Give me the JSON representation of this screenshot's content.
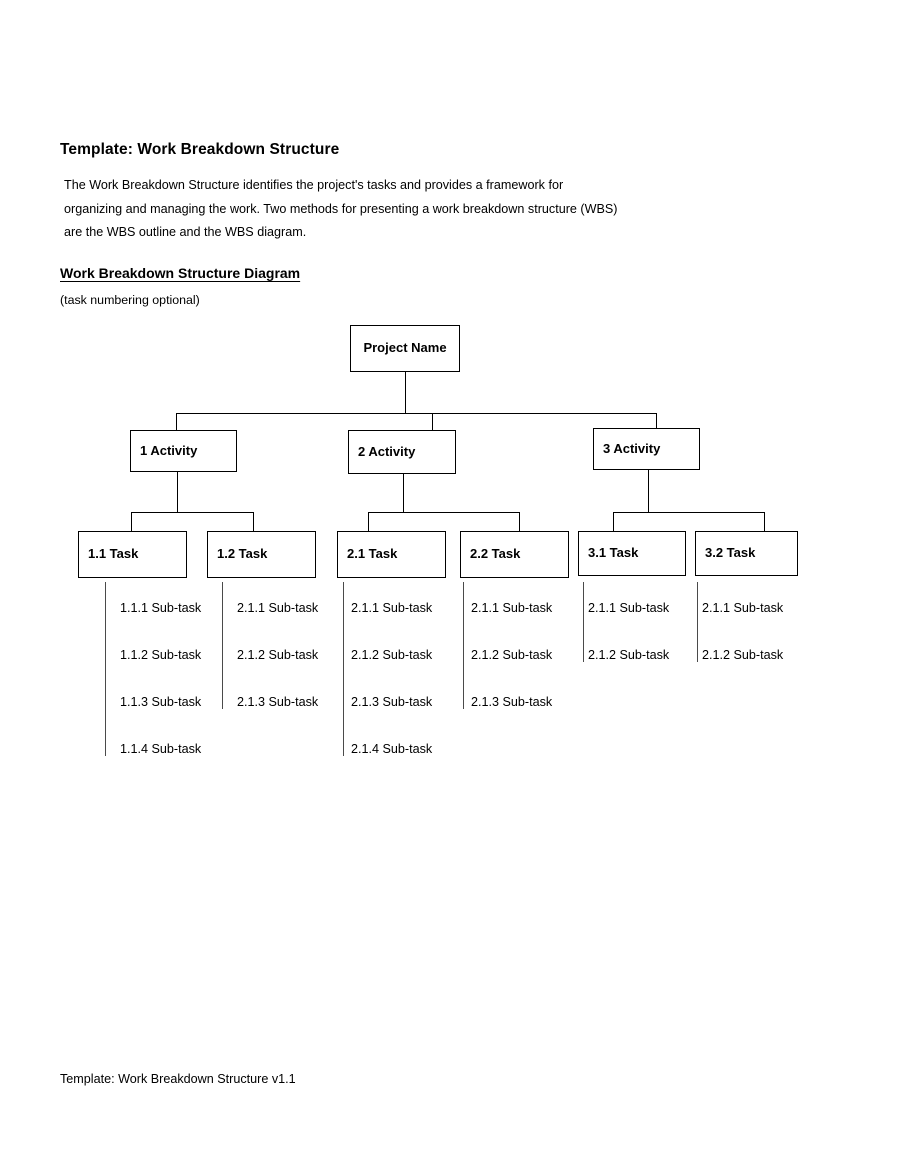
{
  "document": {
    "title": "Template: Work Breakdown Structure",
    "intro": "The Work Breakdown Structure identifies the project's tasks and provides a framework for organizing and managing the work. Two methods for presenting a work breakdown structure (WBS) are the WBS outline and the WBS diagram.",
    "section_heading": "Work Breakdown Structure Diagram",
    "section_note": "(task numbering optional)",
    "footer": "Template: Work Breakdown Structure v1.1"
  },
  "chart_data": {
    "type": "diagram",
    "diagram_kind": "work-breakdown-structure-tree",
    "title": "Work Breakdown Structure Diagram",
    "orientation": "top-down",
    "levels": [
      "project",
      "activity",
      "task",
      "sub-task"
    ],
    "colors": {
      "box_border": "#000000",
      "box_fill": "#ffffff",
      "connector": "#000000",
      "subtask_rail": "#4a4a4a",
      "text": "#000000",
      "page_background": "#ffffff"
    },
    "nodes": {
      "root": {
        "id": "project",
        "label": "Project Name",
        "level": 0
      },
      "activities": [
        {
          "id": "1",
          "label": "1 Activity",
          "level": 1,
          "parent": "project"
        },
        {
          "id": "2",
          "label": "2 Activity",
          "level": 1,
          "parent": "project"
        },
        {
          "id": "3",
          "label": "3 Activity",
          "level": 1,
          "parent": "project"
        }
      ],
      "tasks": [
        {
          "id": "1.1",
          "label": "1.1 Task",
          "level": 2,
          "parent": "1"
        },
        {
          "id": "1.2",
          "label": "1.2 Task",
          "level": 2,
          "parent": "1"
        },
        {
          "id": "2.1",
          "label": "2.1 Task",
          "level": 2,
          "parent": "2"
        },
        {
          "id": "2.2",
          "label": "2.2 Task",
          "level": 2,
          "parent": "2"
        },
        {
          "id": "3.1",
          "label": "3.1 Task",
          "level": 2,
          "parent": "3"
        },
        {
          "id": "3.2",
          "label": "3.2 Task",
          "level": 2,
          "parent": "3"
        }
      ]
    },
    "subtask_columns": [
      {
        "parent": "1.1 Task",
        "count": 4,
        "items": [
          "1.1.1 Sub-task",
          "1.1.2 Sub-task",
          "1.1.3 Sub-task",
          "1.1.4 Sub-task"
        ]
      },
      {
        "parent": "1.2 Task",
        "count": 3,
        "items": [
          "2.1.1 Sub-task",
          "2.1.2 Sub-task",
          "2.1.3 Sub-task"
        ]
      },
      {
        "parent": "2.1 Task",
        "count": 4,
        "items": [
          "2.1.1 Sub-task",
          "2.1.2 Sub-task",
          "2.1.3 Sub-task",
          "2.1.4 Sub-task"
        ]
      },
      {
        "parent": "2.2 Task",
        "count": 3,
        "items": [
          "2.1.1 Sub-task",
          "2.1.2 Sub-task",
          "2.1.3 Sub-task"
        ]
      },
      {
        "parent": "3.1 Task",
        "count": 2,
        "items": [
          "2.1.1 Sub-task",
          "2.1.2 Sub-task"
        ]
      },
      {
        "parent": "3.2 Task",
        "count": 2,
        "items": [
          "2.1.1 Sub-task",
          "2.1.2 Sub-task"
        ]
      }
    ]
  }
}
